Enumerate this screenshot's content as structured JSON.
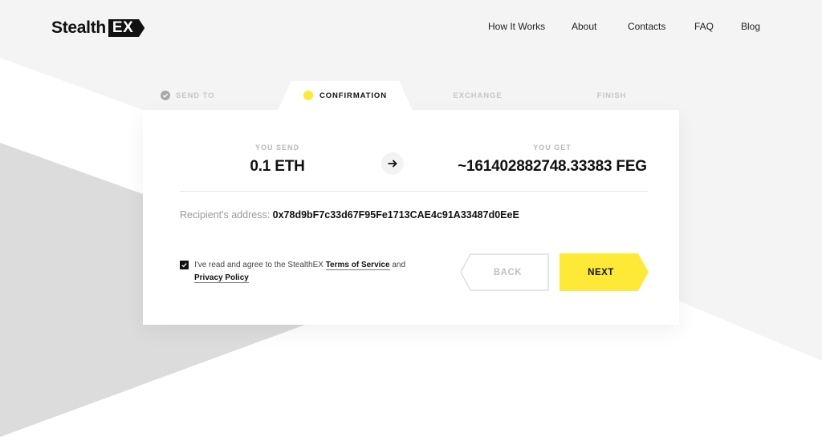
{
  "brand": {
    "name_part1": "Stealth",
    "name_part2": "EX"
  },
  "nav": {
    "items": [
      {
        "label": "How It Works"
      },
      {
        "label": "About"
      },
      {
        "label": "Contacts"
      },
      {
        "label": "FAQ"
      },
      {
        "label": "Blog"
      }
    ]
  },
  "steps": [
    {
      "label": "SEND TO",
      "state": "done"
    },
    {
      "label": "CONFIRMATION",
      "state": "active"
    },
    {
      "label": "EXCHANGE",
      "state": "pending"
    },
    {
      "label": "FINISH",
      "state": "pending"
    }
  ],
  "colors": {
    "accent": "#ffe937",
    "text": "#111111",
    "muted": "#c6c6c6",
    "background_light": "#f4f4f4",
    "background_dark": "#dcdcdc"
  },
  "exchange": {
    "send_label": "YOU SEND",
    "send_value": "0.1 ETH",
    "get_label": "YOU GET",
    "get_value": "~161402882748.33383 FEG",
    "arrow_icon": "arrow-right"
  },
  "recipient": {
    "label": "Recipient's address:",
    "address": "0x78d9bF7c33d67F95Fe1713CAE4c91A33487d0EeE"
  },
  "agreement": {
    "checked": true,
    "text_before": "I've read and agree to the StealthEX ",
    "terms_link": "Terms of Service",
    "text_middle": " and ",
    "privacy_link": "Privacy Policy"
  },
  "buttons": {
    "back": "BACK",
    "next": "NEXT"
  }
}
